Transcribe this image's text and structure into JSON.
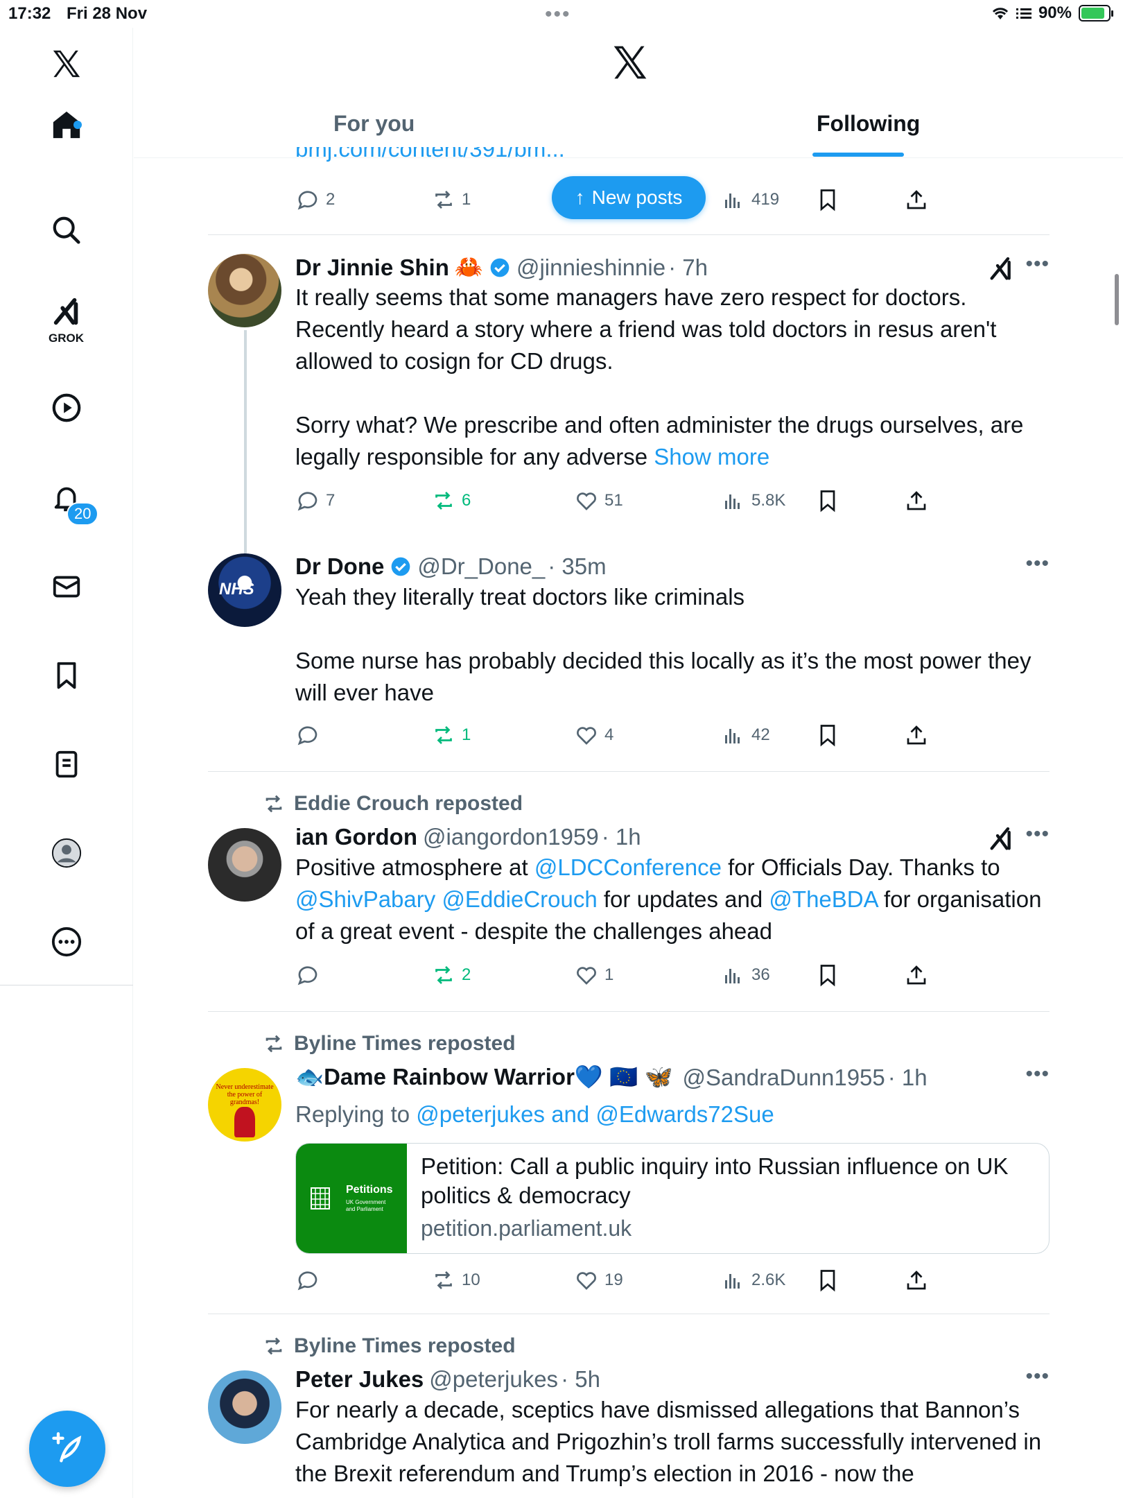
{
  "status": {
    "time": "17:32",
    "date": "Fri 28 Nov",
    "battery": "90%"
  },
  "sidebar": {
    "notifications_badge": "20",
    "grok_label": "GROK"
  },
  "header": {
    "tab_foryou": "For you",
    "tab_following": "Following"
  },
  "new_posts_label": "New posts",
  "top_post": {
    "link_text": "bmj.com/content/391/bm...",
    "replies": "2",
    "reposts": "1",
    "views": "419"
  },
  "posts": [
    {
      "name": "Dr Jinnie Shin",
      "emoji": "🦀",
      "handle": "@jinnieshinnie",
      "time": "· 7h",
      "text1": "It really seems that some managers have zero respect for doctors. Recently heard a story where a friend was told doctors in resus aren't allowed to cosign for CD drugs.",
      "text2": "Sorry what? We prescribe and often administer the drugs ourselves, are legally responsible for any adverse",
      "show_more": "Show more",
      "replies": "7",
      "reposts": "6",
      "likes": "51",
      "views": "5.8K"
    },
    {
      "name": "Dr Done",
      "handle": "@Dr_Done_",
      "time": "· 35m",
      "text1": "Yeah they literally treat doctors like criminals",
      "text2": "Some nurse has probably decided this locally as it’s the most power they will ever have",
      "replies": "",
      "reposts": "1",
      "likes": "4",
      "views": "42"
    },
    {
      "reposted_by": "Eddie Crouch reposted",
      "name": "ian Gordon",
      "handle": "@iangordon1959",
      "time": "· 1h",
      "t1": "Positive atmosphere at ",
      "m1": "@LDCConference",
      "t2": " for Officials Day. Thanks to ",
      "m2": "@ShivPabary",
      "m3": "@EddieCrouch",
      "t3": " for updates and ",
      "m4": "@TheBDA",
      "t4": " for organisation of a great event - despite the challenges ahead",
      "replies": "",
      "reposts": "2",
      "likes": "1",
      "views": "36"
    },
    {
      "reposted_by": "Byline Times reposted",
      "name": "🐟Dame Rainbow Warrior💙 🇪🇺 🦋",
      "handle": "@SandraDunn1955",
      "time": "· 1h",
      "replying_prefix": "Replying to ",
      "replying_to": "@peterjukes and @Edwards72Sue",
      "card_title": "Petition: Call a public inquiry into Russian influence on UK politics & democracy",
      "card_domain": "petition.parliament.uk",
      "card_thumb_title": "Petitions",
      "card_thumb_sub": "UK Government and Parliament",
      "replies": "",
      "reposts": "10",
      "likes": "19",
      "views": "2.6K"
    },
    {
      "reposted_by": "Byline Times reposted",
      "name": "Peter Jukes",
      "handle": "@peterjukes",
      "time": "· 5h",
      "text1": "For nearly a decade, sceptics have dismissed allegations that Bannon’s Cambridge Analytica and Prigozhin’s troll farms successfully intervened in the Brexit referendum and Trump’s election in 2016 - now the"
    }
  ],
  "avatar_texts": {
    "nhs": "NHS",
    "grandma": "Never underestimate the power of grandmas!"
  },
  "colors": {
    "accent": "#1d9bf0",
    "repost_green": "#00ba7c",
    "muted": "#536471"
  }
}
